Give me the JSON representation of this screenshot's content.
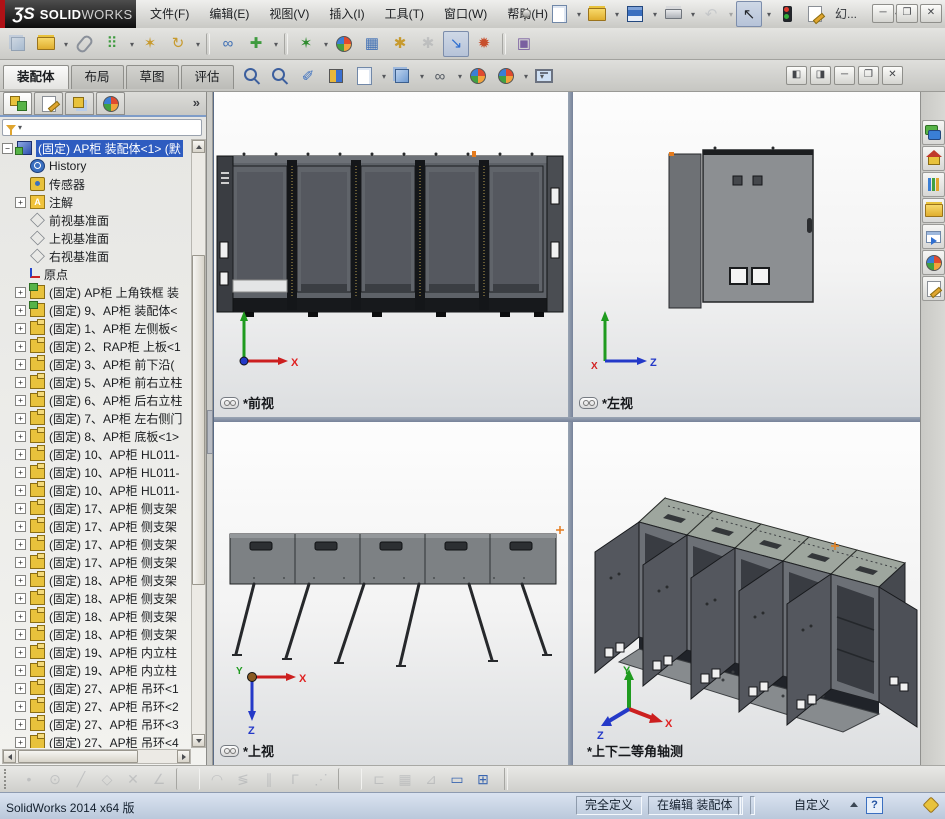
{
  "window": {
    "logo_mark": "ƷS",
    "logo_solid": "SOLID",
    "logo_works": "WORKS",
    "controls": {
      "minimize": "─",
      "restore": "❐",
      "close": "✕"
    }
  },
  "menubar": {
    "items": [
      {
        "name": "menu-file",
        "label": "文件(F)"
      },
      {
        "name": "menu-edit",
        "label": "编辑(E)"
      },
      {
        "name": "menu-view",
        "label": "视图(V)"
      },
      {
        "name": "menu-insert",
        "label": "插入(I)"
      },
      {
        "name": "menu-tools",
        "label": "工具(T)"
      },
      {
        "name": "menu-window",
        "label": "窗口(W)"
      },
      {
        "name": "menu-help",
        "label": "帮助(H)"
      }
    ]
  },
  "quick_toolbar": {
    "items": [
      {
        "name": "new-document-button",
        "kind": "ik-page",
        "caret": true
      },
      {
        "name": "open-document-button",
        "kind": "ik-folder",
        "caret": true
      },
      {
        "name": "save-button",
        "kind": "ik-floppy",
        "caret": true
      },
      {
        "name": "print-button",
        "kind": "ik-printer",
        "caret": true
      },
      {
        "name": "undo-button",
        "glyph": "↶",
        "color": "#a6abb3",
        "disabled": true,
        "caret": true
      },
      {
        "name": "select-button",
        "glyph": "↖",
        "color": "#23262b",
        "pressed": true,
        "caret": true
      },
      {
        "name": "rebuild-button",
        "kind": "ik-traffic"
      },
      {
        "name": "file-properties-button",
        "kind": "ik-docpen"
      },
      {
        "name": "presentation-button",
        "glyph": "幻...",
        "color": "#33363b",
        "wide": true
      },
      {
        "name": "help-button",
        "glyph": "?",
        "color": "#3f5e96",
        "caret": true
      }
    ]
  },
  "assembly_toolbar": {
    "items": [
      {
        "name": "edit-component-button",
        "kind": "ik-cube",
        "disabled": true
      },
      {
        "name": "insert-components-button",
        "kind": "ik-folder",
        "caret": true
      },
      {
        "name": "mate-button",
        "kind": "ik-clip"
      },
      {
        "name": "component-pattern-button",
        "glyph": "⠿",
        "color": "#3f9b3f",
        "caret": true
      },
      {
        "name": "smart-fasteners-button",
        "glyph": "✶",
        "color": "#c79a2e"
      },
      {
        "name": "move-component-button",
        "glyph": "↻",
        "color": "#c79a2e",
        "caret": true
      },
      {
        "sep": true
      },
      {
        "name": "show-hidden-components-button",
        "glyph": "∞",
        "color": "#3f6fb4"
      },
      {
        "name": "assembly-features-button",
        "glyph": "✚",
        "color": "#3f9b3f",
        "caret": true
      },
      {
        "sep": true
      },
      {
        "name": "reference-geometry-button",
        "glyph": "✶",
        "color": "#2e8b2e",
        "caret": true
      },
      {
        "name": "new-motion-study-button",
        "kind": "ik-sphere"
      },
      {
        "name": "bill-of-materials-button",
        "glyph": "▦",
        "color": "#3f6fb4"
      },
      {
        "name": "exploded-view-button",
        "glyph": "✱",
        "color": "#c79a2e"
      },
      {
        "name": "exploded-line-sketch-button",
        "glyph": "✱",
        "color": "#9a9da2",
        "disabled": true
      },
      {
        "name": "instant3d-button",
        "glyph": "↘",
        "color": "#2f6fd0",
        "pressed": true
      },
      {
        "name": "interference-detection-button",
        "glyph": "✹",
        "color": "#c7502e"
      },
      {
        "sep": true
      },
      {
        "name": "snapshot-button",
        "glyph": "▣",
        "color": "#7a5fa0"
      }
    ]
  },
  "command_tabs": {
    "items": [
      {
        "name": "tab-assembly",
        "label": "装配体",
        "active": true
      },
      {
        "name": "tab-layout",
        "label": "布局"
      },
      {
        "name": "tab-sketch",
        "label": "草图"
      },
      {
        "name": "tab-evaluate",
        "label": "评估"
      }
    ]
  },
  "headsup_toolbar": {
    "items": [
      {
        "name": "zoom-fit-button",
        "kind": "ik-magnifier"
      },
      {
        "name": "zoom-area-button",
        "kind": "ik-magnifier"
      },
      {
        "name": "magnified-selection-button",
        "glyph": "✐",
        "color": "#3a6fc0"
      },
      {
        "name": "section-view-button",
        "kind": "ik-section"
      },
      {
        "name": "annotation-views-button",
        "kind": "ik-page",
        "caret": true
      },
      {
        "name": "view-orientation-button",
        "kind": "ik-cube",
        "caret": true
      },
      {
        "name": "hide-show-items-button",
        "glyph": "∞",
        "color": "#555b63",
        "caret": true
      },
      {
        "name": "edit-appearance-button",
        "kind": "ik-sphere"
      },
      {
        "name": "apply-scene-button",
        "kind": "ik-sphere",
        "caret": true
      },
      {
        "name": "view-settings-button",
        "kind": "ik-monitor",
        "caret": true
      }
    ]
  },
  "doc_controls": {
    "split_left": "◧",
    "split_right": "◨",
    "minimize": "─",
    "restore": "❐",
    "close": "✕"
  },
  "panel": {
    "overflow": "»",
    "tabs": [
      {
        "name": "feature-manager-tab",
        "kind": "ik-ftree",
        "active": true
      },
      {
        "name": "property-manager-tab",
        "kind": "ik-docpen"
      },
      {
        "name": "configuration-manager-tab",
        "kind": "ik-config"
      },
      {
        "name": "display-manager-tab",
        "kind": "ik-sphere"
      }
    ]
  },
  "feature_tree": {
    "items": [
      {
        "icon": "i-root",
        "cls": "ind0",
        "expander": "−",
        "expcls": "minus",
        "selected": true,
        "label": "(固定) AP柜 装配体<1> (默"
      },
      {
        "icon": "i-hist",
        "cls": "ind1",
        "expander": "",
        "expcls": "none",
        "label": "History"
      },
      {
        "icon": "i-sens",
        "cls": "ind1",
        "expander": "",
        "expcls": "none",
        "label": "传感器"
      },
      {
        "icon": "i-ann",
        "cls": "ind1",
        "expander": "+",
        "expcls": "plus",
        "label": "注解"
      },
      {
        "icon": "i-plane",
        "cls": "ind1",
        "expander": "",
        "expcls": "none",
        "label": "前视基准面"
      },
      {
        "icon": "i-plane",
        "cls": "ind1",
        "expander": "",
        "expcls": "none",
        "label": "上视基准面"
      },
      {
        "icon": "i-plane",
        "cls": "ind1",
        "expander": "",
        "expcls": "none",
        "label": "右视基准面"
      },
      {
        "icon": "i-origin",
        "cls": "ind1",
        "expander": "",
        "expcls": "none",
        "label": "原点"
      },
      {
        "icon": "i-asm",
        "cls": "ind1",
        "expander": "+",
        "expcls": "plus",
        "label": "(固定) AP柜 上角铁框 装"
      },
      {
        "icon": "i-asm",
        "cls": "ind1",
        "expander": "+",
        "expcls": "plus",
        "label": "(固定) 9、AP柜 装配体<"
      },
      {
        "icon": "i-part",
        "cls": "ind1",
        "expander": "+",
        "expcls": "plus",
        "label": "(固定) 1、AP柜 左侧板<"
      },
      {
        "icon": "i-part",
        "cls": "ind1",
        "expander": "+",
        "expcls": "plus",
        "label": "(固定) 2、RAP柜 上板<1"
      },
      {
        "icon": "i-part",
        "cls": "ind1",
        "expander": "+",
        "expcls": "plus",
        "label": "(固定) 3、AP柜 前下沿("
      },
      {
        "icon": "i-part",
        "cls": "ind1",
        "expander": "+",
        "expcls": "plus",
        "label": "(固定) 5、AP柜 前右立柱"
      },
      {
        "icon": "i-part",
        "cls": "ind1",
        "expander": "+",
        "expcls": "plus",
        "label": "(固定) 6、AP柜 后右立柱"
      },
      {
        "icon": "i-part",
        "cls": "ind1",
        "expander": "+",
        "expcls": "plus",
        "label": "(固定) 7、AP柜 左右侧门"
      },
      {
        "icon": "i-part",
        "cls": "ind1",
        "expander": "+",
        "expcls": "plus",
        "label": "(固定) 8、AP柜 底板<1>"
      },
      {
        "icon": "i-part",
        "cls": "ind1",
        "expander": "+",
        "expcls": "plus",
        "label": "(固定) 10、AP柜 HL011-"
      },
      {
        "icon": "i-part",
        "cls": "ind1",
        "expander": "+",
        "expcls": "plus",
        "label": "(固定) 10、AP柜 HL011-"
      },
      {
        "icon": "i-part",
        "cls": "ind1",
        "expander": "+",
        "expcls": "plus",
        "label": "(固定) 10、AP柜 HL011-"
      },
      {
        "icon": "i-part",
        "cls": "ind1",
        "expander": "+",
        "expcls": "plus",
        "label": "(固定) 17、AP柜 侧支架"
      },
      {
        "icon": "i-part",
        "cls": "ind1",
        "expander": "+",
        "expcls": "plus",
        "label": "(固定) 17、AP柜 侧支架"
      },
      {
        "icon": "i-part",
        "cls": "ind1",
        "expander": "+",
        "expcls": "plus",
        "label": "(固定) 17、AP柜 侧支架"
      },
      {
        "icon": "i-part",
        "cls": "ind1",
        "expander": "+",
        "expcls": "plus",
        "label": "(固定) 17、AP柜 侧支架"
      },
      {
        "icon": "i-part",
        "cls": "ind1",
        "expander": "+",
        "expcls": "plus",
        "label": "(固定) 18、AP柜 侧支架"
      },
      {
        "icon": "i-part",
        "cls": "ind1",
        "expander": "+",
        "expcls": "plus",
        "label": "(固定) 18、AP柜 侧支架"
      },
      {
        "icon": "i-part",
        "cls": "ind1",
        "expander": "+",
        "expcls": "plus",
        "label": "(固定) 18、AP柜 侧支架"
      },
      {
        "icon": "i-part",
        "cls": "ind1",
        "expander": "+",
        "expcls": "plus",
        "label": "(固定) 18、AP柜 侧支架"
      },
      {
        "icon": "i-part",
        "cls": "ind1",
        "expander": "+",
        "expcls": "plus",
        "label": "(固定) 19、AP柜 内立柱"
      },
      {
        "icon": "i-part",
        "cls": "ind1",
        "expander": "+",
        "expcls": "plus",
        "label": "(固定) 19、AP柜 内立柱"
      },
      {
        "icon": "i-part",
        "cls": "ind1",
        "expander": "+",
        "expcls": "plus",
        "label": "(固定) 27、AP柜 吊环<1"
      },
      {
        "icon": "i-part",
        "cls": "ind1",
        "expander": "+",
        "expcls": "plus",
        "label": "(固定) 27、AP柜 吊环<2"
      },
      {
        "icon": "i-part",
        "cls": "ind1",
        "expander": "+",
        "expcls": "plus",
        "label": "(固定) 27、AP柜 吊环<3"
      },
      {
        "icon": "i-part",
        "cls": "ind1",
        "expander": "+",
        "expcls": "plus",
        "label": "(固定) 27、AP柜 吊环<4"
      }
    ]
  },
  "viewports": [
    {
      "name": "front-view",
      "label": "*前视",
      "axes": {
        "right": "X"
      }
    },
    {
      "name": "left-view",
      "label": "*左视",
      "axes": {
        "right": "Z",
        "origin": "X"
      }
    },
    {
      "name": "top-view",
      "label": "*上视",
      "axes": {
        "right": "X",
        "down": "Z",
        "origin": "Y"
      }
    },
    {
      "name": "isometric-view",
      "label": "*上下二等角轴测",
      "axes": {
        "up": "Y",
        "right": "X",
        "left": "Z"
      }
    }
  ],
  "taskpane": {
    "items": [
      {
        "name": "solidworks-forum-tab",
        "kind": "ik-forum"
      },
      {
        "name": "solidworks-resources-tab",
        "kind": "ik-home"
      },
      {
        "name": "design-library-tab",
        "kind": "ik-books"
      },
      {
        "name": "file-explorer-tab",
        "kind": "ik-folder"
      },
      {
        "name": "view-palette-tab",
        "kind": "ik-palette"
      },
      {
        "name": "appearances-tab",
        "kind": "ik-sphere"
      },
      {
        "name": "custom-properties-tab",
        "kind": "ik-docpen"
      }
    ]
  },
  "sketch_toolbar": {
    "items": [
      {
        "name": "sketch-point-button",
        "glyph": "•",
        "color": "#9a9da2",
        "disabled": true
      },
      {
        "name": "circle-button",
        "glyph": "⊙",
        "color": "#9a9da2",
        "disabled": true
      },
      {
        "name": "line-button",
        "glyph": "╱",
        "color": "#9a9da2",
        "disabled": true
      },
      {
        "name": "polygon-button",
        "glyph": "◇",
        "color": "#9a9da2",
        "disabled": true
      },
      {
        "name": "trim-entities-button",
        "glyph": "✕",
        "color": "#9a9da2",
        "disabled": true
      },
      {
        "name": "sketch-fillet-button",
        "glyph": "∠",
        "color": "#9a9da2",
        "disabled": true
      },
      {
        "sep": true
      },
      {
        "name": "convert-entities-button",
        "glyph": "◠",
        "color": "#9a9da2",
        "disabled": true
      },
      {
        "name": "offset-entities-button",
        "glyph": "≶",
        "color": "#9a9da2",
        "disabled": true
      },
      {
        "name": "mirror-entities-button",
        "glyph": "∥",
        "color": "#9a9da2",
        "disabled": true
      },
      {
        "name": "corner-rectangle-button",
        "glyph": "Γ",
        "color": "#9a9da2",
        "disabled": true
      },
      {
        "name": "spline-button",
        "glyph": "⋰",
        "color": "#9a9da2",
        "disabled": true
      },
      {
        "sep": true
      },
      {
        "name": "smart-dimension-button",
        "glyph": "⊏",
        "color": "#9a9da2",
        "disabled": true
      },
      {
        "name": "grid-snap-button",
        "glyph": "▦",
        "color": "#9a9da2",
        "disabled": true
      },
      {
        "name": "angle-dimension-button",
        "glyph": "⊿",
        "color": "#9a9da2",
        "disabled": true
      },
      {
        "name": "rapid-sketch-button",
        "glyph": "▭",
        "color": "#3a66b0"
      },
      {
        "name": "table-button",
        "glyph": "⊞",
        "color": "#3a66b0"
      }
    ]
  },
  "statusbar": {
    "left": "SolidWorks 2014 x64 版",
    "defined": "完全定义",
    "editing": "在编辑 装配体",
    "custom": "自定义",
    "help": "?"
  },
  "colors": {
    "selection_blue": "#2e5cc0",
    "accent_red": "#b01116",
    "cabinet_body_gray": "#60646a",
    "cabinet_frame_dark": "#17191c",
    "cabinet_top_green": "#9ea69e",
    "viewport_bg_top": "#fdfdfd",
    "viewport_bg_bottom": "#dcdee0",
    "status_bg": "#c9d5e4"
  }
}
